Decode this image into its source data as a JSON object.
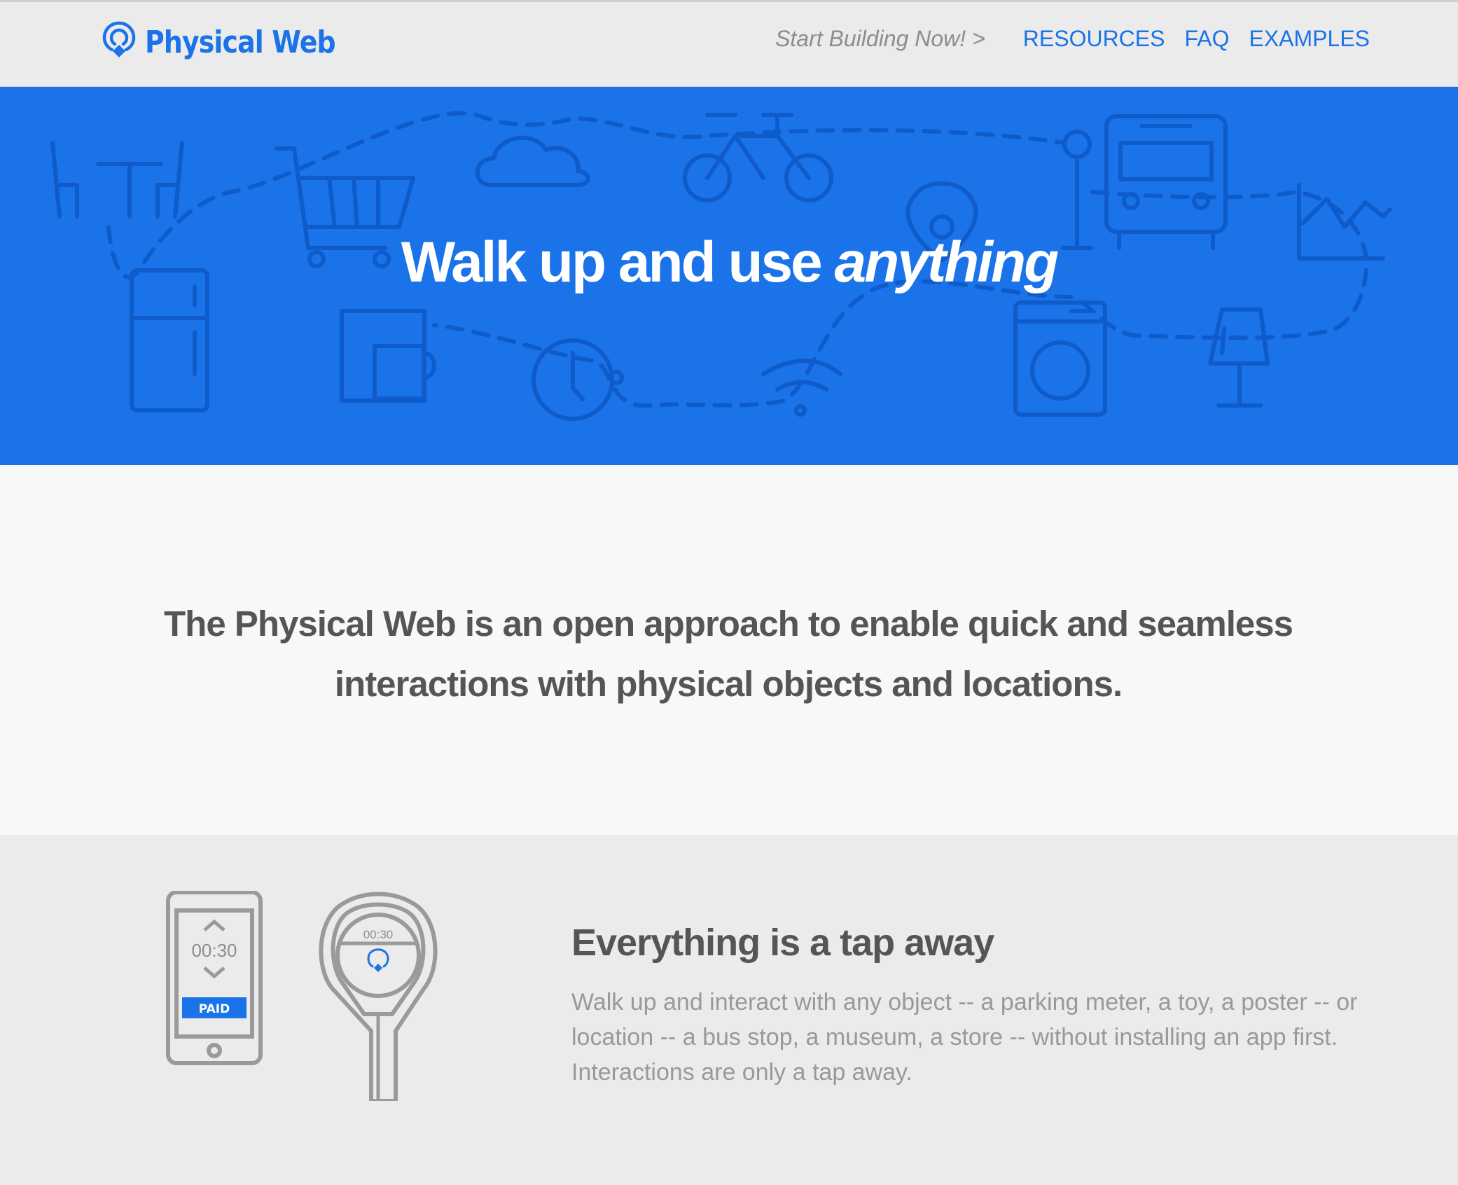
{
  "brand": {
    "name": "Physical Web",
    "logo_icon": "location-pin-beacon-icon",
    "color": "#1a73e8"
  },
  "nav": {
    "cta": "Start Building Now! >",
    "links": [
      {
        "label": "RESOURCES"
      },
      {
        "label": "FAQ"
      },
      {
        "label": "EXAMPLES"
      }
    ]
  },
  "hero": {
    "title_plain": "Walk up and use",
    "title_emphasis": "anything",
    "background_color": "#1a73e8",
    "decorative_icons": [
      "table-chairs-icon",
      "shopping-cart-icon",
      "cloud-icon",
      "bicycle-icon",
      "bus-stop-sign-icon",
      "bus-icon",
      "chart-icon",
      "refrigerator-icon",
      "coffee-maker-icon",
      "clock-icon",
      "wifi-icon",
      "location-pin-icon",
      "washing-machine-icon",
      "lamp-icon"
    ]
  },
  "intro": {
    "text": "The Physical Web is an open approach to enable quick and seamless interactions with physical objects and locations."
  },
  "feature": {
    "title": "Everything is a tap away",
    "description": "Walk up and interact with any object -- a parking meter, a toy, a poster -- or location -- a bus stop, a museum, a store -- without installing an app first. Interactions are only a tap away.",
    "phone": {
      "time": "00:30",
      "status": "PAID"
    },
    "meter": {
      "time": "00:30"
    }
  }
}
